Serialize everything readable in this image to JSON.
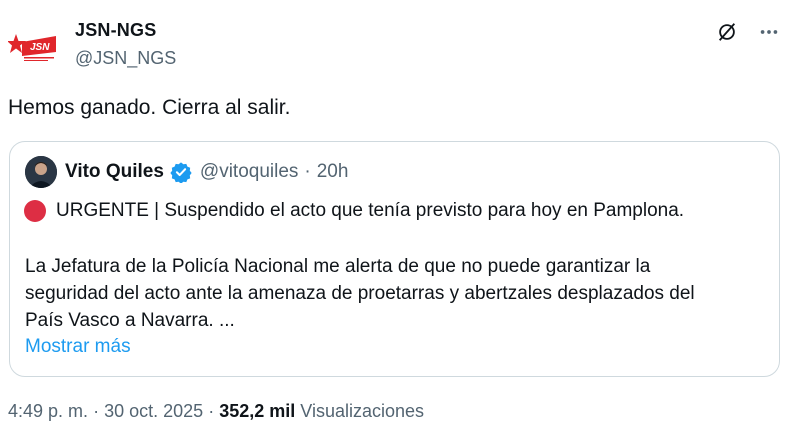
{
  "author": {
    "name": "JSN-NGS",
    "handle": "@JSN_NGS",
    "logo_text": "JSN"
  },
  "tweet": {
    "text": "Hemos ganado. Cierra al salir."
  },
  "actions": {
    "grok_icon": "grok-slash-icon",
    "more_icon": "ellipsis-icon"
  },
  "quote": {
    "name": "Vito Quiles",
    "handle": "@vitoquiles",
    "separator": "·",
    "time": "20h",
    "urgent_text": "URGENTE | Suspendido el acto que tenía previsto para hoy en Pamplona.",
    "body_lines": [
      "La Jefatura de la Policía Nacional me alerta de que no puede garantizar la",
      "seguridad del acto ante la amenaza de proetarras y abertzales desplazados del",
      "País Vasco a Navarra. ..."
    ],
    "show_more": "Mostrar más"
  },
  "meta": {
    "time": "4:49 p. m.",
    "sep1": "·",
    "date": "30 oct. 2025",
    "sep2": "·",
    "views_count": "352,2 mil",
    "views_label": "Visualizaciones"
  },
  "colors": {
    "text": "#0f1419",
    "secondary": "#536471",
    "link": "#1d9bf0",
    "border": "#cfd9de",
    "brand_red": "#e0262b",
    "urgent_red": "#dd2e44",
    "verified": "#1d9bf0"
  }
}
